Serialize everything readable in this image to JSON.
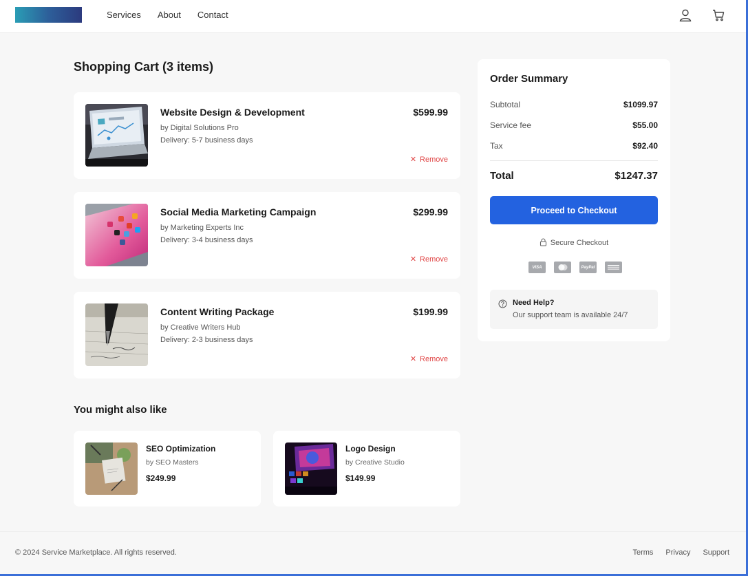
{
  "header": {
    "nav": [
      "Services",
      "About",
      "Contact"
    ],
    "icons": [
      "user-icon",
      "cart-icon"
    ]
  },
  "cart": {
    "title": "Shopping Cart (3 items)",
    "items": [
      {
        "name": "Website Design & Development",
        "vendor": "by Digital Solutions Pro",
        "delivery": "Delivery: 5-7 business days",
        "price": "$599.99",
        "remove_label": "Remove"
      },
      {
        "name": "Social Media Marketing Campaign",
        "vendor": "by Marketing Experts Inc",
        "delivery": "Delivery: 3-4 business days",
        "price": "$299.99",
        "remove_label": "Remove"
      },
      {
        "name": "Content Writing Package",
        "vendor": "by Creative Writers Hub",
        "delivery": "Delivery: 2-3 business days",
        "price": "$199.99",
        "remove_label": "Remove"
      }
    ]
  },
  "suggestions": {
    "title": "You might also like",
    "items": [
      {
        "name": "SEO Optimization",
        "vendor": "by SEO Masters",
        "price": "$249.99"
      },
      {
        "name": "Logo Design",
        "vendor": "by Creative Studio",
        "price": "$149.99"
      }
    ]
  },
  "summary": {
    "title": "Order Summary",
    "rows": [
      {
        "label": "Subtotal",
        "value": "$1099.97"
      },
      {
        "label": "Service fee",
        "value": "$55.00"
      },
      {
        "label": "Tax",
        "value": "$92.40"
      }
    ],
    "total_label": "Total",
    "total_value": "$1247.37",
    "checkout_label": "Proceed to Checkout",
    "secure_label": "Secure Checkout",
    "payment_methods": [
      "VISA",
      "",
      "PayPal",
      ""
    ],
    "help_title": "Need Help?",
    "help_text": "Our support team is available 24/7"
  },
  "footer": {
    "copyright": "© 2024 Service Marketplace. All rights reserved.",
    "links": [
      "Terms",
      "Privacy",
      "Support"
    ]
  },
  "colors": {
    "accent": "#2362e0",
    "remove": "#e04646",
    "background": "#f7f7f7"
  }
}
